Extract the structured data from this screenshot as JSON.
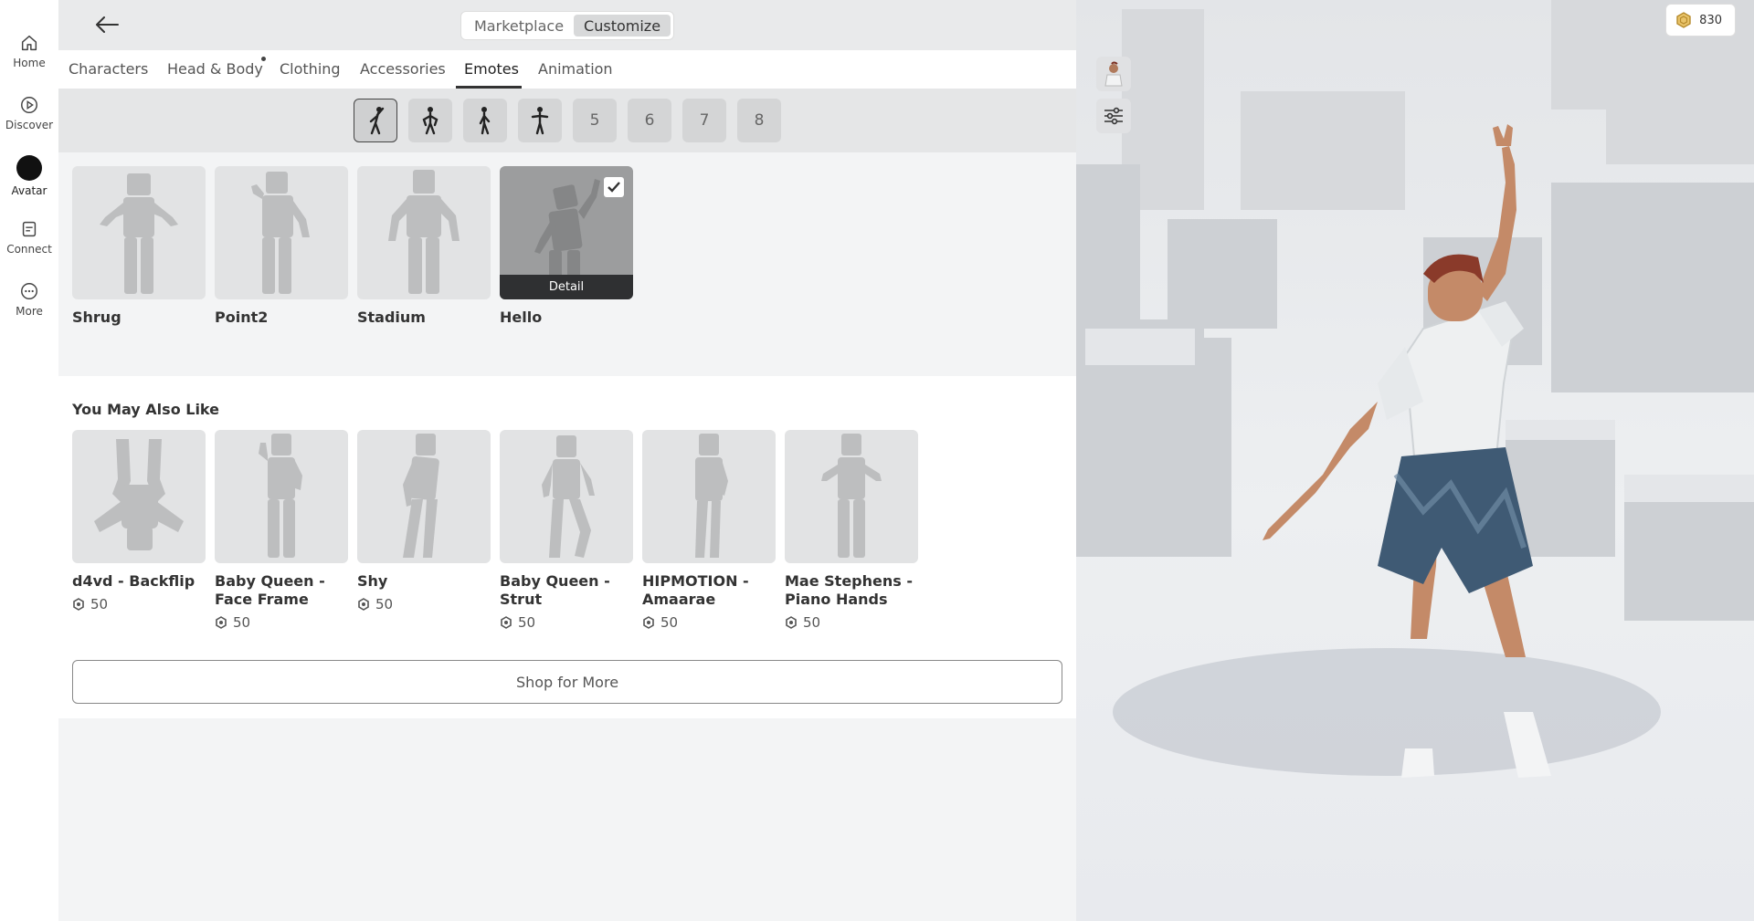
{
  "nav": [
    {
      "label": "Home",
      "icon": "home-icon"
    },
    {
      "label": "Discover",
      "icon": "discover-icon"
    },
    {
      "label": "Avatar",
      "icon": "avatar-icon"
    },
    {
      "label": "Connect",
      "icon": "connect-icon"
    },
    {
      "label": "More",
      "icon": "more-icon"
    }
  ],
  "header": {
    "segment": [
      "Marketplace",
      "Customize"
    ],
    "active_segment": "Customize"
  },
  "tabs": [
    "Characters",
    "Head & Body",
    "Clothing",
    "Accessories",
    "Emotes",
    "Animation"
  ],
  "active_tab": "Emotes",
  "slots": [
    "",
    "",
    "",
    "",
    "5",
    "6",
    "7",
    "8"
  ],
  "equipped": [
    {
      "name": "Shrug"
    },
    {
      "name": "Point2"
    },
    {
      "name": "Stadium"
    },
    {
      "name": "Hello",
      "detail": "Detail"
    }
  ],
  "recommendations": {
    "title": "You May Also Like",
    "items": [
      {
        "name": "d4vd - Backflip",
        "price": "50"
      },
      {
        "name": "Baby Queen - Face Frame",
        "price": "50"
      },
      {
        "name": "Shy",
        "price": "50"
      },
      {
        "name": "Baby Queen - Strut",
        "price": "50"
      },
      {
        "name": "HIPMOTION - Amaarae",
        "price": "50"
      },
      {
        "name": "Mae Stephens - Piano Hands",
        "price": "50"
      }
    ],
    "shop_label": "Shop for More"
  },
  "robux": {
    "balance": "830"
  },
  "colors": {
    "accent": "#333333",
    "selected_thumb": "#9c9d9e",
    "coin": "#c9a24a"
  }
}
